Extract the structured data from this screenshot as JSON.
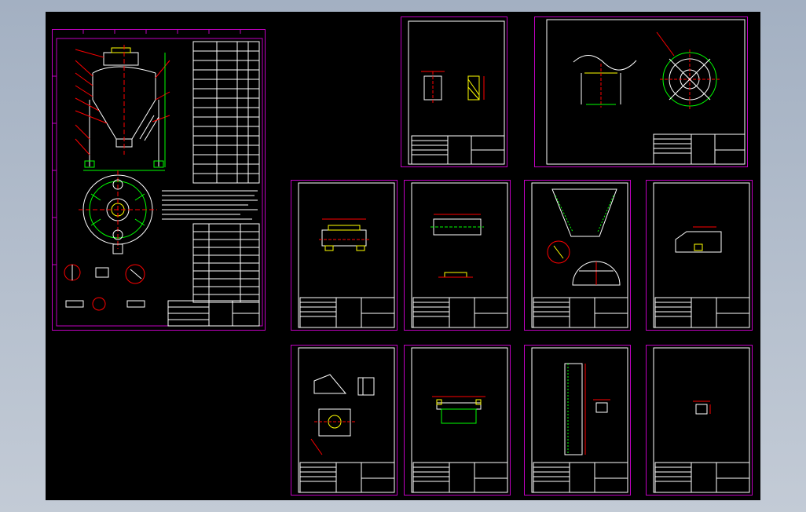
{
  "viewport": {
    "background": "#000000",
    "frame_color": "#c000c0",
    "line_color": "#ffffff"
  },
  "sheets": [
    {
      "id": "main-assembly"
    },
    {
      "id": "small-part-top"
    },
    {
      "id": "lid-assembly"
    },
    {
      "id": "part-r2-1"
    },
    {
      "id": "part-r2-2"
    },
    {
      "id": "part-r2-3"
    },
    {
      "id": "part-r2-4"
    },
    {
      "id": "part-r3-1"
    },
    {
      "id": "part-r3-2"
    },
    {
      "id": "part-r3-3"
    },
    {
      "id": "part-r3-4"
    }
  ]
}
